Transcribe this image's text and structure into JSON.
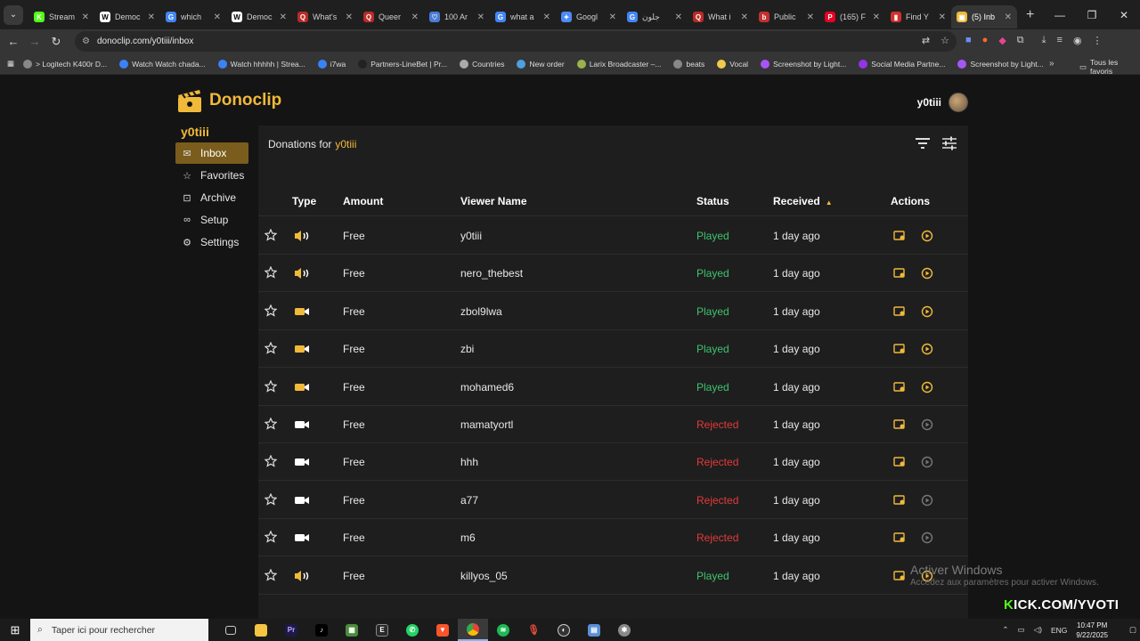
{
  "browser": {
    "tabs": [
      {
        "title": "Stream",
        "favicon": "K",
        "color": "#53fc18"
      },
      {
        "title": "Democ",
        "favicon": "W",
        "color": "#ffffff"
      },
      {
        "title": "which",
        "favicon": "G",
        "color": "#4285f4"
      },
      {
        "title": "Democ",
        "favicon": "W",
        "color": "#ffffff"
      },
      {
        "title": "What's",
        "favicon": "Q",
        "color": "#b92b27"
      },
      {
        "title": "Queer",
        "favicon": "Q",
        "color": "#b92b27"
      },
      {
        "title": "100 Ar",
        "favicon": "♡",
        "color": "#4a7bd6"
      },
      {
        "title": "what a",
        "favicon": "G",
        "color": "#4285f4"
      },
      {
        "title": "Googl",
        "favicon": "✦",
        "color": "#4c8bf5"
      },
      {
        "title": "جلون",
        "favicon": "G",
        "color": "#4285f4"
      },
      {
        "title": "What i",
        "favicon": "Q",
        "color": "#b92b27"
      },
      {
        "title": "Public",
        "favicon": "b",
        "color": "#c23030"
      },
      {
        "title": "(165) F",
        "favicon": "P",
        "color": "#e60023"
      },
      {
        "title": "Find Y",
        "favicon": "▮",
        "color": "#d32f2f"
      },
      {
        "title": "(5) Inb",
        "favicon": "▣",
        "color": "#f0b93a",
        "active": true
      }
    ],
    "url": "donoclip.com/y0tiii/inbox",
    "bookmarks": [
      {
        "label": "> Logitech K400r D...",
        "color": "#888888"
      },
      {
        "label": "Watch Watch chada...",
        "color": "#3b82f6"
      },
      {
        "label": "Watch hhhhh | Strea...",
        "color": "#3b82f6"
      },
      {
        "label": "i7wa",
        "color": "#3b82f6"
      },
      {
        "label": "Partners-LineBet | Pr...",
        "color": "#222222"
      },
      {
        "label": "Countries",
        "color": "#aaaaaa"
      },
      {
        "label": "New order",
        "color": "#4ea0e0"
      },
      {
        "label": "Larix Broadcaster –...",
        "color": "#9ab34a"
      },
      {
        "label": "beats",
        "color": "#888888"
      },
      {
        "label": "Vocal",
        "color": "#f2c94c"
      },
      {
        "label": "Screenshot by Light...",
        "color": "#a855f7"
      },
      {
        "label": "Social Media Partne...",
        "color": "#9333ea"
      },
      {
        "label": "Screenshot by Light...",
        "color": "#a855f7"
      }
    ],
    "all_bookmarks": "Tous les favoris"
  },
  "app": {
    "brand": "Donoclip",
    "brand_color": "#f0b93a",
    "username": "y0tiii",
    "nav": [
      {
        "label": "Inbox",
        "icon": "inbox-icon",
        "active": true
      },
      {
        "label": "Favorites",
        "icon": "star-icon"
      },
      {
        "label": "Archive",
        "icon": "archive-icon"
      },
      {
        "label": "Setup",
        "icon": "link-icon"
      },
      {
        "label": "Settings",
        "icon": "gear-icon"
      }
    ],
    "panel_title": "Donations for",
    "columns": {
      "type": "Type",
      "amount": "Amount",
      "viewer": "Viewer Name",
      "status": "Status",
      "received": "Received",
      "actions": "Actions"
    },
    "rows": [
      {
        "type": "sound-video",
        "amount": "Free",
        "viewer": "y0tiii",
        "status": "Played",
        "received": "1 day ago"
      },
      {
        "type": "sound-video",
        "amount": "Free",
        "viewer": "nero_thebest",
        "status": "Played",
        "received": "1 day ago"
      },
      {
        "type": "video",
        "amount": "Free",
        "viewer": "zbol9lwa",
        "status": "Played",
        "received": "1 day ago"
      },
      {
        "type": "video",
        "amount": "Free",
        "viewer": "zbi",
        "status": "Played",
        "received": "1 day ago"
      },
      {
        "type": "video",
        "amount": "Free",
        "viewer": "mohamed6",
        "status": "Played",
        "received": "1 day ago"
      },
      {
        "type": "video",
        "amount": "Free",
        "viewer": "mamatyortl",
        "status": "Rejected",
        "received": "1 day ago"
      },
      {
        "type": "video",
        "amount": "Free",
        "viewer": "hhh",
        "status": "Rejected",
        "received": "1 day ago"
      },
      {
        "type": "video",
        "amount": "Free",
        "viewer": "a77",
        "status": "Rejected",
        "received": "1 day ago"
      },
      {
        "type": "video",
        "amount": "Free",
        "viewer": "m6",
        "status": "Rejected",
        "received": "1 day ago"
      },
      {
        "type": "sound-video",
        "amount": "Free",
        "viewer": "killyos_05",
        "status": "Played",
        "received": "1 day ago"
      }
    ]
  },
  "overlay": {
    "activate_title": "Activer Windows",
    "activate_sub": "Accédez aux paramètres pour activer Windows.",
    "kick_prefix": "K",
    "kick_rest": "ICK.COM/YVOTI"
  },
  "taskbar": {
    "search_placeholder": "Taper ici pour rechercher",
    "lang": "ENG",
    "time": "10:47 PM",
    "date": "9/22/2025"
  }
}
